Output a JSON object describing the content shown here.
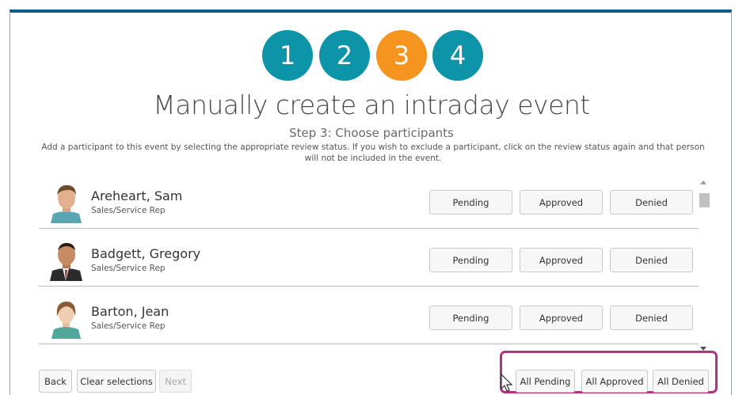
{
  "steps": [
    {
      "label": "1",
      "color": "#0e94a9"
    },
    {
      "label": "2",
      "color": "#0e94a9"
    },
    {
      "label": "3",
      "color": "#f69420"
    },
    {
      "label": "4",
      "color": "#0e94a9"
    }
  ],
  "header": {
    "title": "Manually create an intraday event",
    "subtitle": "Step 3: Choose participants",
    "instructions": "Add a participant to this event by selecting the appropriate review status. If you wish to exclude a participant, click on the review status again and that person will not be included in the event."
  },
  "participants": [
    {
      "name": "Areheart, Sam",
      "role": "Sales/Service Rep"
    },
    {
      "name": "Badgett, Gregory",
      "role": "Sales/Service Rep"
    },
    {
      "name": "Barton, Jean",
      "role": "Sales/Service Rep"
    }
  ],
  "status_buttons": {
    "pending": "Pending",
    "approved": "Approved",
    "denied": "Denied"
  },
  "footer": {
    "back": "Back",
    "clear": "Clear selections",
    "next": "Next",
    "all_pending": "All Pending",
    "all_approved": "All Approved",
    "all_denied": "All Denied"
  },
  "colors": {
    "accent_top": "#0f5a8a",
    "highlight": "#b4317f",
    "step_active": "#f69420",
    "step_default": "#0e94a9"
  }
}
